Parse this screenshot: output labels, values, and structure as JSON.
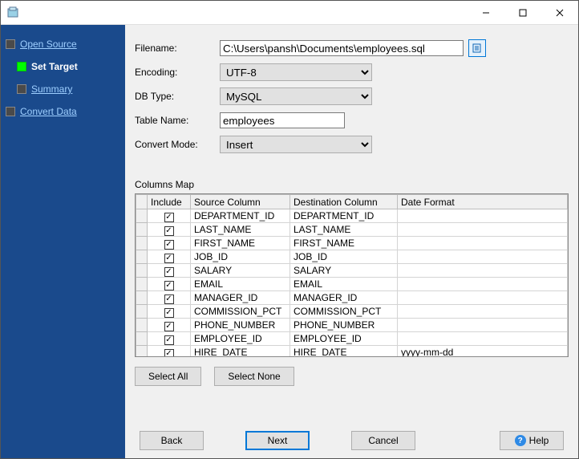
{
  "steps": {
    "open_source": "Open Source",
    "set_target": "Set Target",
    "summary": "Summary",
    "convert_data": "Convert Data"
  },
  "form": {
    "labels": {
      "filename": "Filename:",
      "encoding": "Encoding:",
      "db_type": "DB Type:",
      "table_name": "Table Name:",
      "convert_mode": "Convert Mode:"
    },
    "filename": "C:\\Users\\pansh\\Documents\\employees.sql",
    "encoding": "UTF-8",
    "db_type": "MySQL",
    "table_name": "employees",
    "convert_mode": "Insert"
  },
  "columns_map": {
    "title": "Columns Map",
    "headers": {
      "include": "Include",
      "source": "Source Column",
      "dest": "Destination Column",
      "date_format": "Date Format"
    },
    "rows": [
      {
        "include": true,
        "source": "DEPARTMENT_ID",
        "dest": "DEPARTMENT_ID",
        "fmt": ""
      },
      {
        "include": true,
        "source": "LAST_NAME",
        "dest": "LAST_NAME",
        "fmt": ""
      },
      {
        "include": true,
        "source": "FIRST_NAME",
        "dest": "FIRST_NAME",
        "fmt": ""
      },
      {
        "include": true,
        "source": "JOB_ID",
        "dest": "JOB_ID",
        "fmt": ""
      },
      {
        "include": true,
        "source": "SALARY",
        "dest": "SALARY",
        "fmt": ""
      },
      {
        "include": true,
        "source": "EMAIL",
        "dest": "EMAIL",
        "fmt": ""
      },
      {
        "include": true,
        "source": "MANAGER_ID",
        "dest": "MANAGER_ID",
        "fmt": ""
      },
      {
        "include": true,
        "source": "COMMISSION_PCT",
        "dest": "COMMISSION_PCT",
        "fmt": ""
      },
      {
        "include": true,
        "source": "PHONE_NUMBER",
        "dest": "PHONE_NUMBER",
        "fmt": ""
      },
      {
        "include": true,
        "source": "EMPLOYEE_ID",
        "dest": "EMPLOYEE_ID",
        "fmt": ""
      },
      {
        "include": true,
        "source": "HIRE_DATE",
        "dest": "HIRE_DATE",
        "fmt": "yyyy-mm-dd"
      }
    ]
  },
  "buttons": {
    "select_all": "Select All",
    "select_none": "Select None",
    "back": "Back",
    "next": "Next",
    "cancel": "Cancel",
    "help": "Help"
  }
}
